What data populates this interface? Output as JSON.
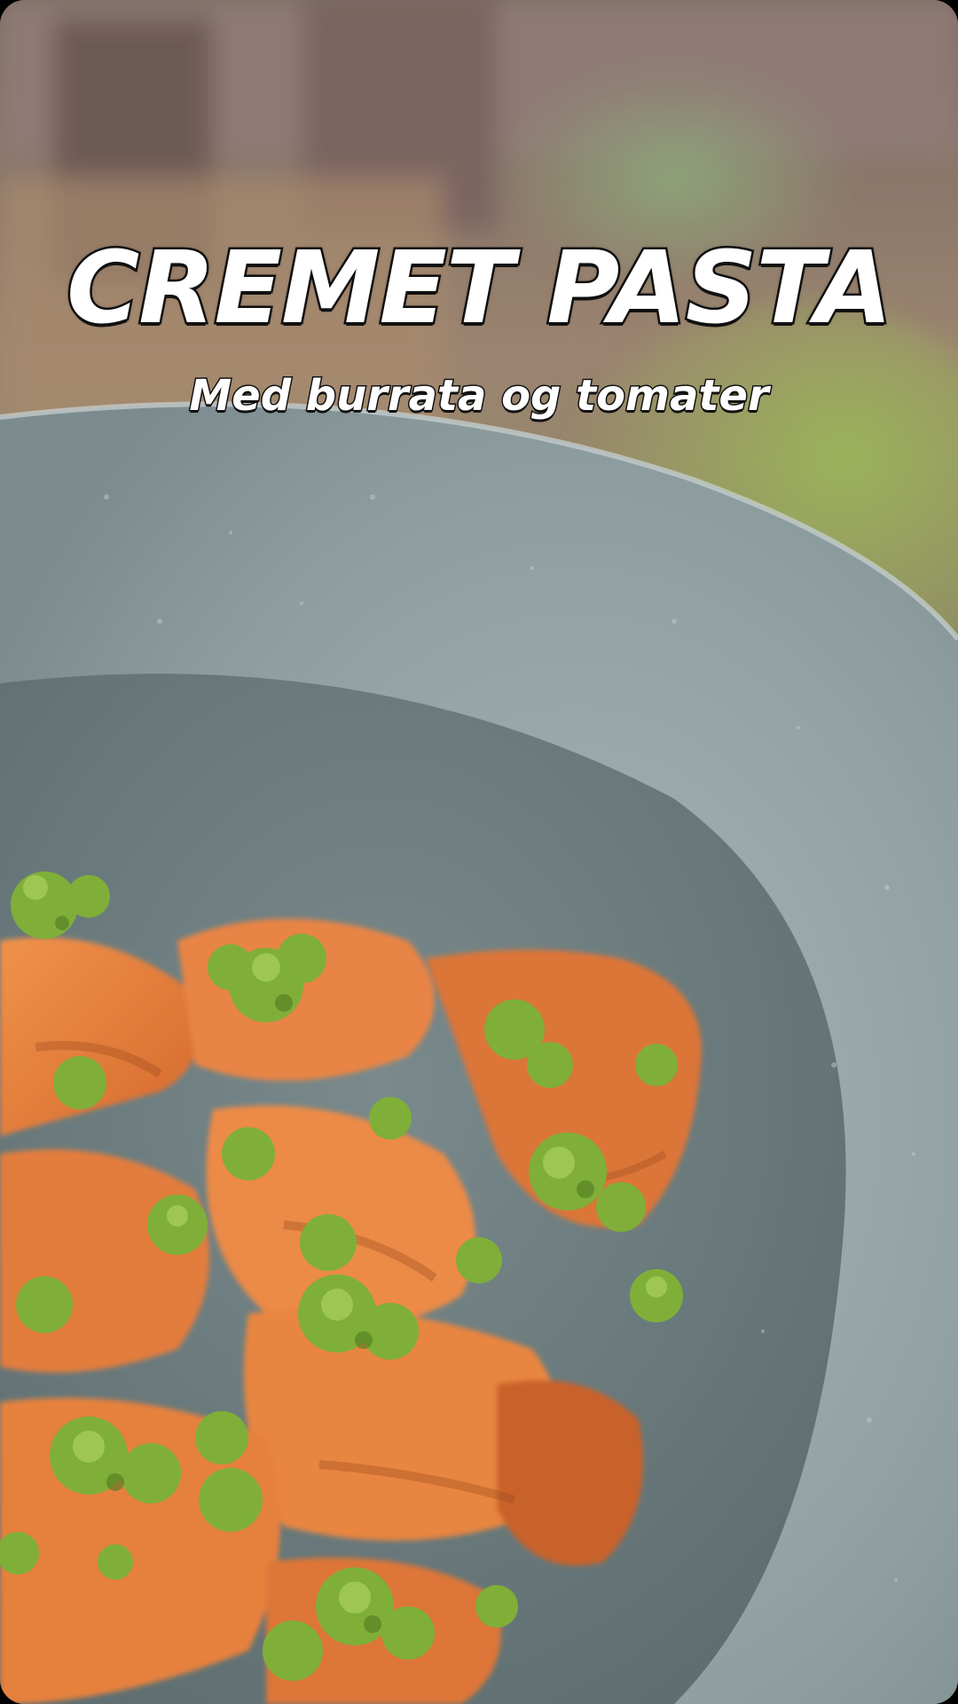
{
  "overlay": {
    "title": "CREMET PASTA",
    "subtitle": "Med burrata og tomater"
  },
  "colors": {
    "text": "#ffffff",
    "text_outline": "#111111",
    "bowl": "#8fa0a3",
    "sauce": "#e07a3a",
    "pesto": "#7fae3a"
  }
}
